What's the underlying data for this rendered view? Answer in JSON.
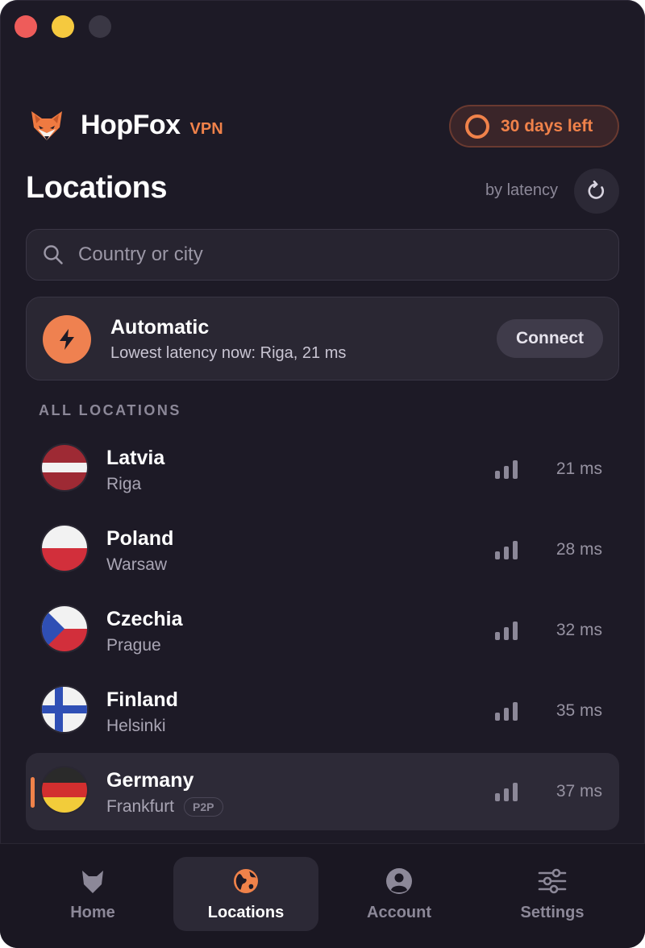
{
  "app": {
    "name": "HopFox",
    "tag": "VPN",
    "subscription": "30 days left",
    "accent_color": "#f0824a"
  },
  "page": {
    "title": "Locations",
    "sort_label": "by latency"
  },
  "search": {
    "placeholder": "Country or city",
    "value": ""
  },
  "automatic": {
    "title": "Automatic",
    "subtitle": "Lowest latency now: Riga, 21 ms",
    "button": "Connect",
    "icon": "bolt-icon"
  },
  "section_label": "ALL LOCATIONS",
  "locations": [
    {
      "country": "Latvia",
      "city": "Riga",
      "latency": "21 ms",
      "flag": "latvia-flag-icon",
      "signal_bars": 3
    },
    {
      "country": "Poland",
      "city": "Warsaw",
      "latency": "28 ms",
      "flag": "poland-flag-icon",
      "signal_bars": 3
    },
    {
      "country": "Czechia",
      "city": "Prague",
      "latency": "32 ms",
      "flag": "czechia-flag-icon",
      "signal_bars": 3
    },
    {
      "country": "Finland",
      "city": "Helsinki",
      "latency": "35 ms",
      "flag": "finland-flag-icon",
      "signal_bars": 3
    },
    {
      "country": "Germany",
      "city": "Frankfurt",
      "latency": "37 ms",
      "flag": "germany-flag-icon",
      "badge": "P2P",
      "selected": true,
      "signal_bars": 3
    }
  ],
  "nav": [
    {
      "label": "Home",
      "icon": "fox-icon",
      "active": false
    },
    {
      "label": "Locations",
      "icon": "globe-icon",
      "active": true
    },
    {
      "label": "Account",
      "icon": "user-icon",
      "active": false
    },
    {
      "label": "Settings",
      "icon": "sliders-icon",
      "active": false
    }
  ]
}
